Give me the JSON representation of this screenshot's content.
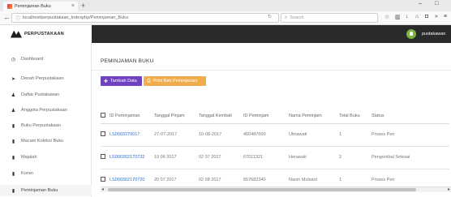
{
  "browser": {
    "tab_title": "Peminjaman Buku",
    "tab_close": "×",
    "new_tab": "+",
    "minimize": "–",
    "maximize": "□",
    "url": "localhost/perpustakaan_Indexphp/Peminjaman_Buku",
    "search_placeholder": "Search"
  },
  "header": {
    "brand_name": "PERPUSTAKAAN",
    "user_name": "pustakawan"
  },
  "sidebar": {
    "items": [
      {
        "label": "Dashboard",
        "icon": "dashboard-icon",
        "glyph": "◷"
      },
      {
        "label": "Denah Perpustakaan",
        "icon": "send-icon",
        "glyph": "➤"
      },
      {
        "label": "Daftar Pustakawan",
        "icon": "user-icon",
        "glyph": "♟"
      },
      {
        "label": "Anggota Perpustakaan",
        "icon": "users-icon",
        "glyph": "♟"
      },
      {
        "label": "Buku Perpustakaan",
        "icon": "book-icon",
        "glyph": "▮"
      },
      {
        "label": "Macam Koleksi Buku",
        "icon": "book-icon",
        "glyph": "▮"
      },
      {
        "label": "Majalah",
        "icon": "book-icon",
        "glyph": "▮"
      },
      {
        "label": "Koran",
        "icon": "book-icon",
        "glyph": "▮"
      },
      {
        "label": "Peminjaman Buku",
        "icon": "book-icon",
        "glyph": "▮"
      }
    ]
  },
  "main": {
    "title": "PEMINJAMAN BUKU",
    "btn_tambah": "Tambah Data",
    "btn_cetak": "Print Bab Peminjaman"
  },
  "table": {
    "columns": [
      "ID Peminjaman",
      "Tanggal Pinjam",
      "Tanggal Kembali",
      "ID Peminjam",
      "Nama Peminjam",
      "Total Buku",
      "Status"
    ],
    "rows": [
      {
        "id": "LS0003270017",
        "pinjam": "27-07-2017",
        "kembali": "10-08-2017",
        "peminjam": "450487600",
        "nama": "Ulinawati",
        "total": "1",
        "status": "Proses Pen"
      },
      {
        "id": "LS000302170732",
        "pinjam": "19 06 2017",
        "kembali": "02 07 2017",
        "peminjam": "67011321",
        "nama": "Herawati",
        "total": "2",
        "status": "Pengembal Selesai"
      },
      {
        "id": "LS000302170720",
        "pinjam": "20 07 2017",
        "kembali": "02 08 2017",
        "peminjam": "657682340",
        "nama": "Nanin Mulsani",
        "total": "1",
        "status": "Proses Pen"
      }
    ]
  },
  "colors": {
    "topbar": "#2a2a2a",
    "btn_tambah": "#6f42c1",
    "btn_cetak": "#f0ad4e",
    "link": "#2f6fd0",
    "avatar": "#7cb342"
  }
}
